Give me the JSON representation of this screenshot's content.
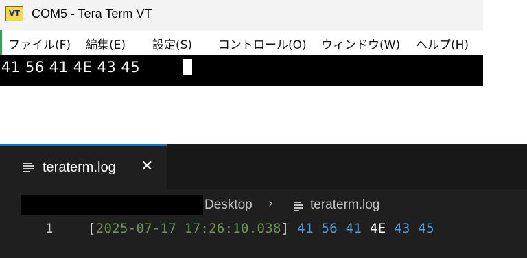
{
  "teraterm": {
    "icon_label": "VT",
    "title": "COM5 - Tera Term VT",
    "menu": [
      "ファイル(F)",
      "編集(E)",
      "設定(S)",
      "コントロール(O)",
      "ウィンドウ(W)",
      "ヘルプ(H)"
    ],
    "terminal_text": "41 56 41 4E 43 45"
  },
  "vscode": {
    "tab_label": "teraterm.log",
    "close_glyph": "✕",
    "breadcrumb": {
      "folder": "Desktop",
      "separator": "›",
      "file": "teraterm.log"
    },
    "line": {
      "number": "1",
      "open_bracket": "[",
      "timestamp": "2025-07-17 17:26:10.038",
      "close_bracket": "]",
      "values": [
        "41",
        "56",
        "41",
        "4E",
        "43",
        "45"
      ]
    }
  },
  "colors": {
    "accent": "#0078d4",
    "timestamp": "#6a9955",
    "hex_value": "#569cd6"
  }
}
